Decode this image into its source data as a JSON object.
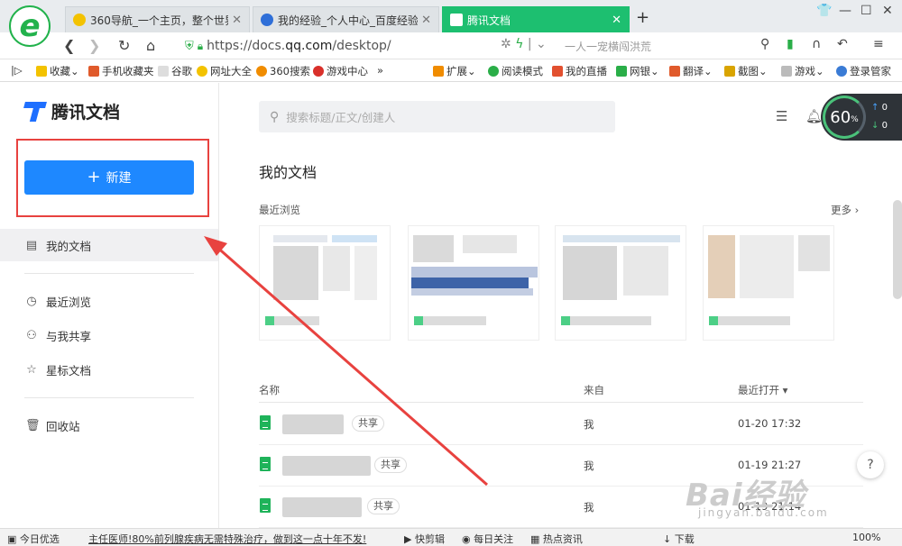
{
  "browser": {
    "tabs": [
      {
        "title": "360导航_一个主页，整个世界",
        "active": false
      },
      {
        "title": "我的经验_个人中心_百度经验",
        "active": false
      },
      {
        "title": "腾讯文档",
        "active": true
      }
    ],
    "new_tab": "+",
    "url_prefix": "https://docs.",
    "url_domain": "qq.com",
    "url_path": "/desktop/",
    "search_hint": "一人一宠横闯洪荒",
    "bookmarks": [
      "收藏",
      "手机收藏夹",
      "谷歌",
      "网址大全",
      "360搜索",
      "游戏中心",
      "»",
      "扩展",
      "阅读模式",
      "我的直播",
      "网银",
      "翻译",
      "截图",
      "游戏",
      "登录管家"
    ]
  },
  "sidebar": {
    "brand": "腾讯文档",
    "new_button": "新建",
    "new_plus": "+",
    "nav": [
      {
        "label": "我的文档",
        "active": true,
        "icon": "document-icon"
      },
      {
        "label": "最近浏览",
        "active": false,
        "icon": "clock-icon"
      },
      {
        "label": "与我共享",
        "active": false,
        "icon": "person-icon"
      },
      {
        "label": "星标文档",
        "active": false,
        "icon": "star-icon"
      },
      {
        "label": "回收站",
        "active": false,
        "icon": "trash-icon"
      }
    ]
  },
  "main": {
    "search_placeholder": "搜索标题/正文/创建人",
    "title": "我的文档",
    "recent_label": "最近浏览",
    "more_label": "更多 ›",
    "columns": {
      "name": "名称",
      "from": "来自",
      "opened": "最近打开 ▾"
    },
    "rows": [
      {
        "tag": "共享",
        "from": "我",
        "time": "01-20 17:32"
      },
      {
        "tag": "共享",
        "from": "我",
        "time": "01-19 21:27"
      },
      {
        "tag": "共享",
        "from": "我",
        "time": "01-19 21:14"
      }
    ],
    "help": "?"
  },
  "speed_widget": {
    "percent": "60",
    "unit": "%",
    "up": "0",
    "down": "0"
  },
  "statusbar": {
    "left": "今日优选",
    "news": "主任医师!80%前列腺疾病无需特殊治疗，做到这一点十年不发!",
    "items": [
      "快剪辑",
      "每日关注",
      "热点资讯",
      "下载",
      "100%"
    ]
  },
  "watermark": {
    "main": "Bai经验",
    "sub": "jingyan.baidu.com"
  },
  "colors": {
    "accent": "#1e88ff",
    "tab_active": "#1dbf70",
    "annotation": "#e8423f",
    "doc_green": "#1fb35a"
  }
}
